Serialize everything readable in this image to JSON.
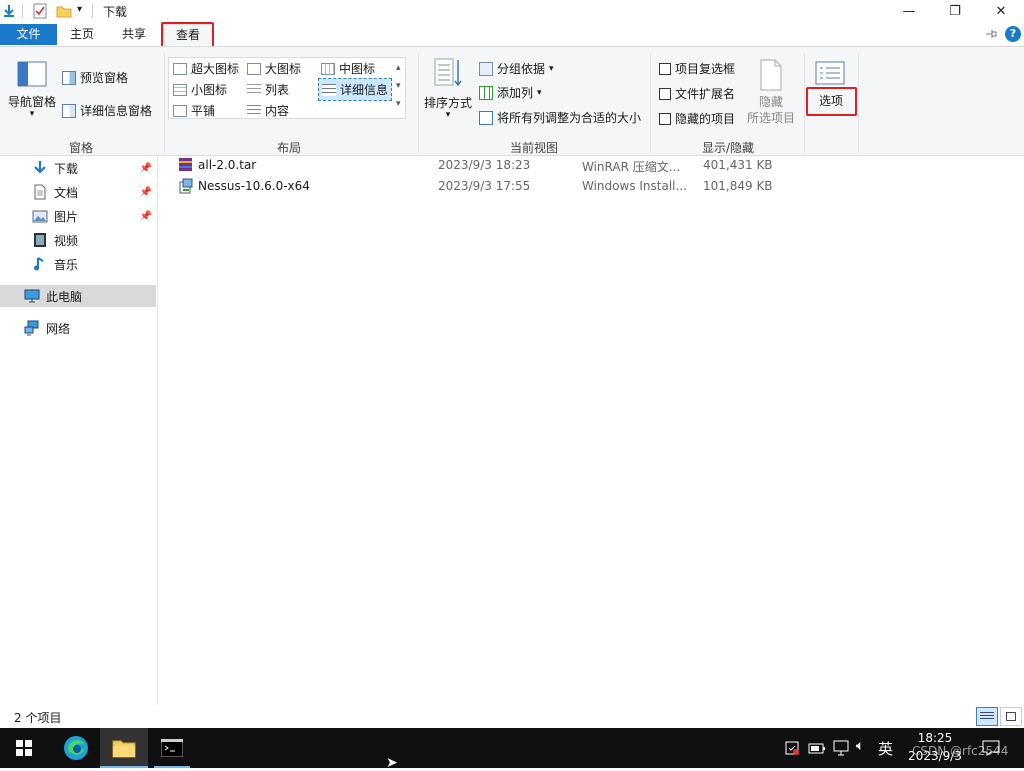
{
  "window": {
    "title": "下载"
  },
  "tabs": [
    {
      "label": "文件"
    },
    {
      "label": "主页"
    },
    {
      "label": "共享"
    },
    {
      "label": "查看"
    }
  ],
  "ribbon": {
    "panes": {
      "nav_pane": "导航窗格",
      "preview_pane": "预览窗格",
      "details_pane": "详细信息窗格",
      "group_label": "窗格"
    },
    "layout": {
      "items": [
        "超大图标",
        "大图标",
        "中图标",
        "小图标",
        "列表",
        "详细信息",
        "平铺",
        "内容"
      ],
      "group_label": "布局"
    },
    "current_view": {
      "sort": "排序方式",
      "group_by": "分组依据",
      "add_column": "添加列",
      "fit_columns": "将所有列调整为合适的大小",
      "group_label": "当前视图"
    },
    "show_hide": {
      "item_checkboxes": "项目复选框",
      "file_extensions": "文件扩展名",
      "hidden_items": "隐藏的项目",
      "hide_selected_1": "隐藏",
      "hide_selected_2": "所选项目",
      "group_label": "显示/隐藏"
    },
    "options": {
      "label": "选项"
    }
  },
  "nav": {
    "items": [
      {
        "label": "下载",
        "icon": "download-arrow-icon"
      },
      {
        "label": "文档",
        "icon": "document-icon"
      },
      {
        "label": "图片",
        "icon": "picture-icon"
      },
      {
        "label": "视频",
        "icon": "video-icon"
      },
      {
        "label": "音乐",
        "icon": "music-note-icon"
      },
      {
        "label": "此电脑",
        "icon": "computer-icon"
      },
      {
        "label": "网络",
        "icon": "network-icon"
      }
    ]
  },
  "files": [
    {
      "name": "all-2.0.tar",
      "date": "2023/9/3 18:23",
      "type": "WinRAR 压缩文...",
      "size": "401,431 KB"
    },
    {
      "name": "Nessus-10.6.0-x64",
      "date": "2023/9/3 17:55",
      "type": "Windows Install...",
      "size": "101,849 KB"
    }
  ],
  "status": {
    "count": "2 个项目"
  },
  "taskbar": {
    "lang": "英",
    "time": "18:25",
    "date": "2023/9/3",
    "watermark": "CSDN @rfc2544"
  },
  "colors": {
    "file_tab": "#1979ca",
    "highlight_red": "#e02020",
    "selected_nav": "#d9d9d9",
    "taskbar": "#101010"
  }
}
